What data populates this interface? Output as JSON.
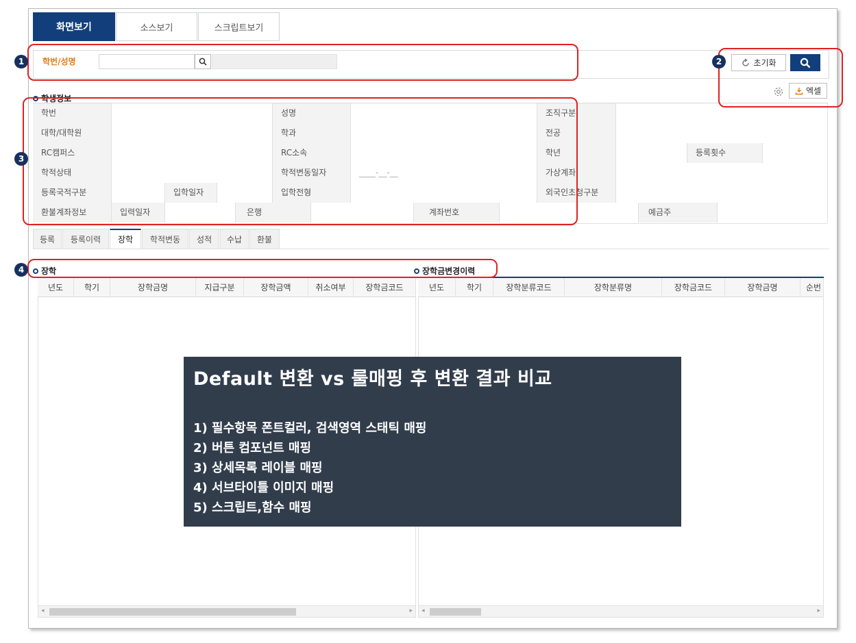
{
  "tabs": [
    "화면보기",
    "소스보기",
    "스크립트보기"
  ],
  "search": {
    "label": "학번/성명",
    "input_value": "",
    "reset_label": "초기화",
    "excel_label": "엑셀"
  },
  "badges": [
    "1",
    "2",
    "3",
    "4"
  ],
  "student_info": {
    "title": "학생정보",
    "rows": [
      [
        "학번",
        "",
        "성명",
        "",
        "조직구분",
        ""
      ],
      [
        "대학/대학원",
        "",
        "학과",
        "",
        "전공",
        ""
      ],
      [
        "RC캠퍼스",
        "",
        "RC소속",
        "",
        "학년",
        "",
        "등록횟수",
        ""
      ],
      [
        "학적상태",
        "",
        "학적변동일자",
        "____-__-__",
        "가상계좌",
        ""
      ],
      [
        "등록국적구분",
        "",
        "입학일자",
        "",
        "입학전형",
        "",
        "외국인초청구분",
        ""
      ],
      [
        "환불계좌정보",
        "입력일자",
        "",
        "은행",
        "",
        "계좌번호",
        "",
        "예금주",
        ""
      ]
    ]
  },
  "sub_tabs": [
    "등록",
    "등록이력",
    "장학",
    "학적변동",
    "성적",
    "수납",
    "환불"
  ],
  "scholarship": {
    "title": "장학",
    "columns": [
      "년도",
      "학기",
      "장학금명",
      "지급구분",
      "장학금액",
      "취소여부",
      "장학금코드"
    ]
  },
  "scholarship_history": {
    "title": "장학금변경이력",
    "columns": [
      "년도",
      "학기",
      "장학분류코드",
      "장학분류명",
      "장학금코드",
      "장학금명",
      "순번"
    ]
  },
  "overlay": {
    "title": "Default 변환 vs 룰매핑 후 변환 결과 비교",
    "items": [
      "1) 필수항목 폰트컬러, 검색영역 스태틱 매핑",
      "2) 버튼 컴포넌트 매핑",
      "3) 상세목록 레이블 매핑",
      "4) 서브타이틀 이미지 매핑",
      "5) 스크립트,함수 매핑"
    ]
  }
}
